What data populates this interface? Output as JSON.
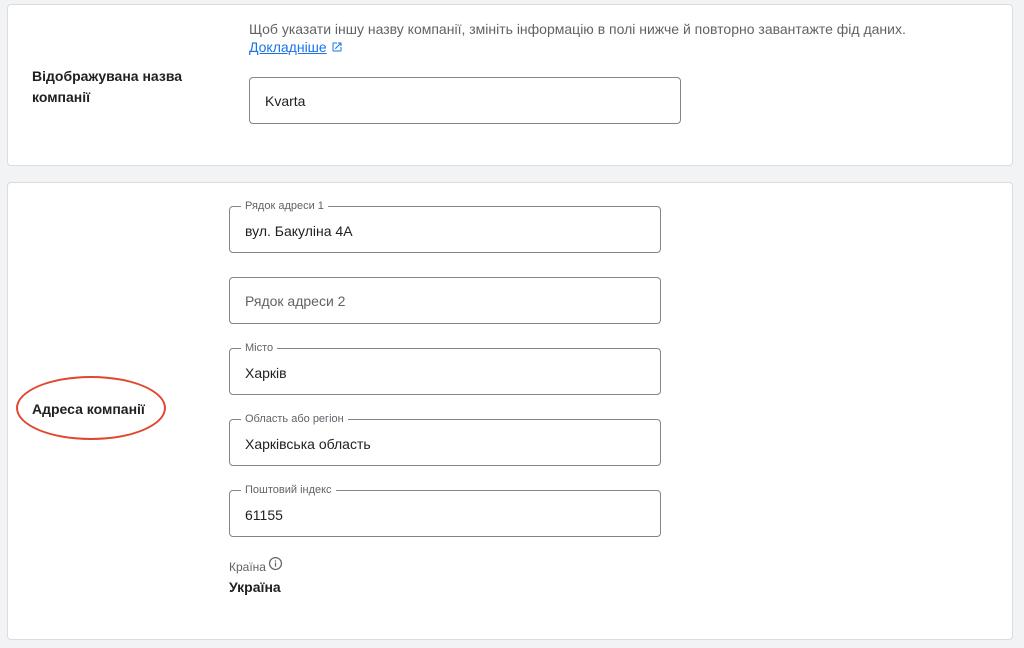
{
  "display_name_section": {
    "label": "Відображувана назва компанії",
    "hint": "Щоб указати іншу назву компанії, змініть інформацію в полі нижче й повторно завантажте фід даних.",
    "learn_more": "Докладніше",
    "value": "Kvarta"
  },
  "address_section": {
    "label": "Адреса компанії",
    "highlight_color": "#e0472d",
    "fields": {
      "address_line_1": {
        "label": "Рядок адреси 1",
        "value": "вул. Бакуліна 4А"
      },
      "address_line_2": {
        "placeholder": "Рядок адреси 2",
        "value": ""
      },
      "city": {
        "label": "Місто",
        "value": "Харків"
      },
      "region": {
        "label": "Область або регіон",
        "value": "Харківська область"
      },
      "postal_code": {
        "label": "Поштовий індекс",
        "value": "61155"
      }
    },
    "country": {
      "label": "Країна",
      "value": "Україна",
      "info_icon": "info-icon"
    }
  },
  "colors": {
    "link": "#1a73e8",
    "text": "#202124",
    "secondary_text": "#5f6368",
    "border": "#80868b"
  }
}
